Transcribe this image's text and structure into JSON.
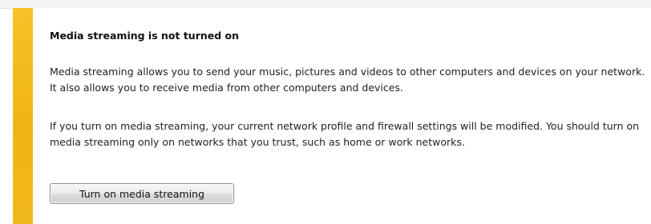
{
  "notice": {
    "title": "Media streaming is not turned on",
    "paragraph_1": "Media streaming allows you to send your music, pictures and videos to other computers and devices on your network.  It also allows you to receive media from other computers and devices.",
    "paragraph_2": "If you turn on media streaming, your current network profile and firewall settings will be modified. You should turn on media streaming only on networks that you trust, such as home or work networks.",
    "button_label": "Turn on media streaming"
  },
  "colors": {
    "accent": "#f2b91a",
    "background": "#ffffff"
  }
}
